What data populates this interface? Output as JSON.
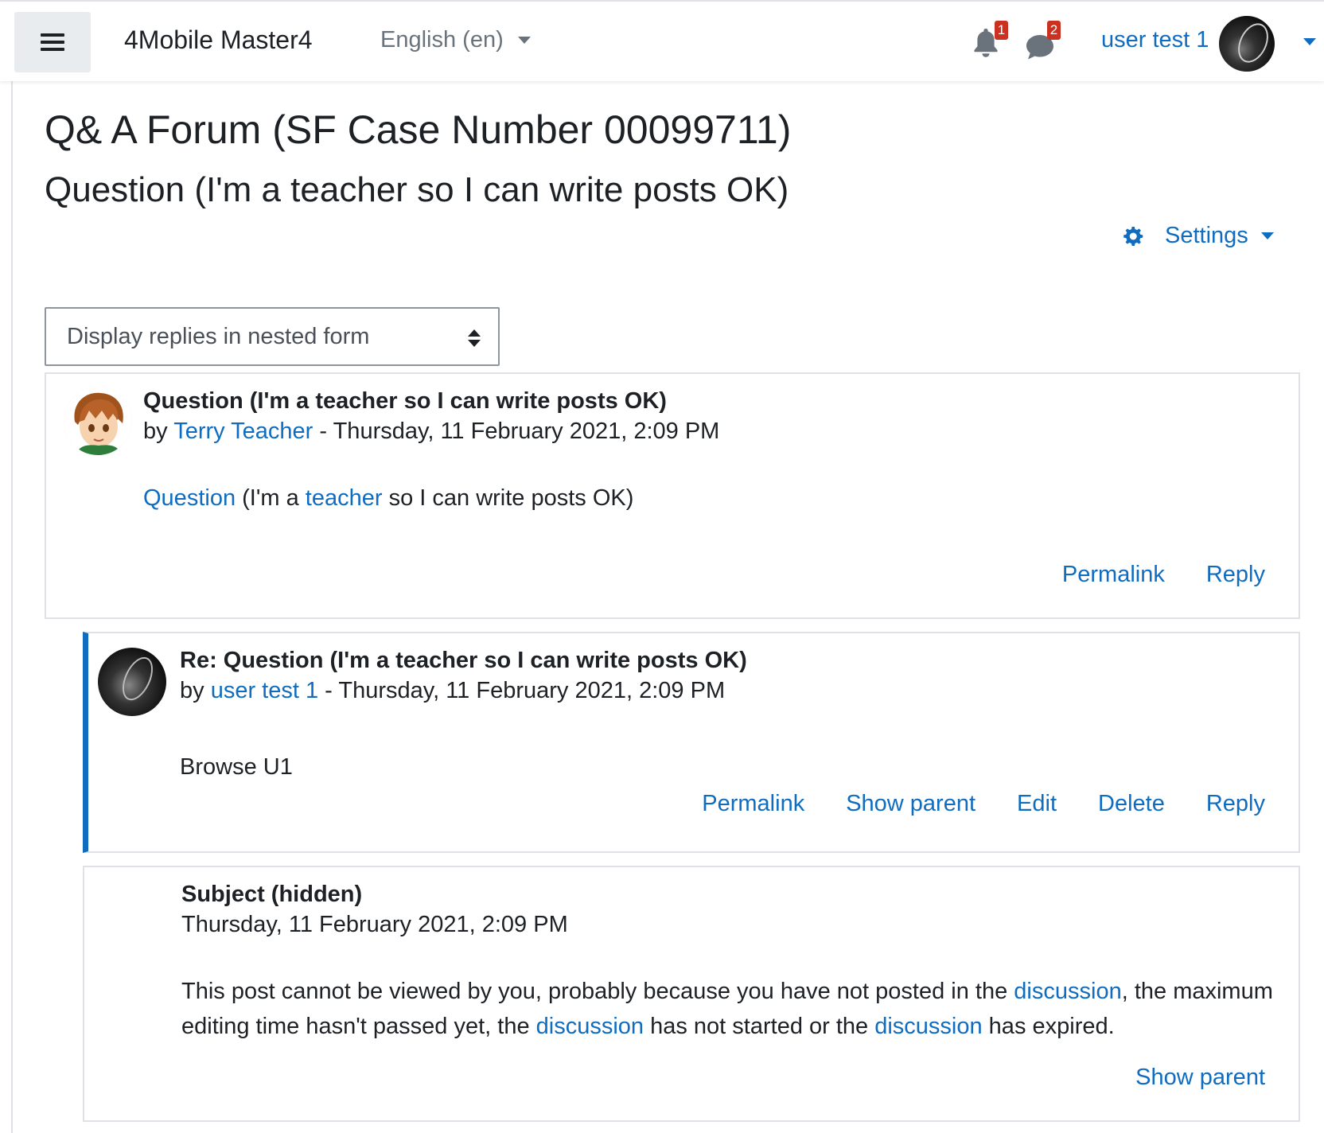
{
  "navbar": {
    "site_name": "4Mobile Master4",
    "language": "English (en)",
    "notifications_count": "1",
    "messages_count": "2",
    "user_name": "user test 1"
  },
  "page": {
    "title": "Q& A Forum (SF Case Number 00099711)",
    "subtitle": "Question (I'm a teacher so I can write posts OK)",
    "settings_label": "Settings"
  },
  "display_select": {
    "selected": "Display replies in nested form"
  },
  "posts": [
    {
      "subject": "Question (I'm a teacher so I can write posts OK)",
      "by": "by",
      "author": "Terry Teacher",
      "date": " - Thursday, 11 February 2021, 2:09 PM",
      "content_parts": [
        "Question",
        " (I'm a ",
        "teacher",
        " so I can write posts OK)"
      ],
      "actions": [
        "Permalink",
        "Reply"
      ]
    },
    {
      "subject": "Re: Question (I'm a teacher so I can write posts OK)",
      "by": "by",
      "author": "user test 1",
      "date": " - Thursday, 11 February 2021, 2:09 PM",
      "content": "Browse U1",
      "actions": [
        "Permalink",
        "Show parent",
        "Edit",
        "Delete",
        "Reply"
      ]
    },
    {
      "subject": "Subject (hidden)",
      "date": "Thursday, 11 February 2021, 2:09 PM",
      "content_parts": [
        "This post cannot be viewed by you, probably because you have not posted in the ",
        "discussion",
        ", the maximum editing time hasn't passed yet, the ",
        "discussion",
        " has not started or the ",
        "discussion",
        " has expired."
      ],
      "actions": [
        "Show parent"
      ]
    }
  ],
  "colors": {
    "link": "#0f6cbf",
    "text": "#1d2125",
    "badge": "#ca3120",
    "border": "#dee2e6"
  }
}
